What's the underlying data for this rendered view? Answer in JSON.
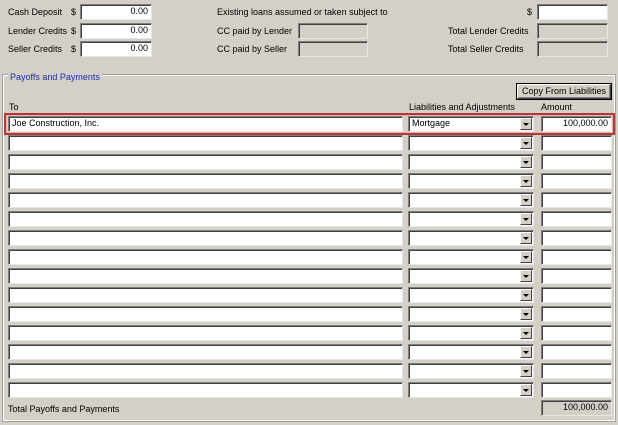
{
  "top": {
    "cash_deposit": {
      "label": "Cash Deposit",
      "currency": "$",
      "value": "0.00"
    },
    "lender_credits": {
      "label": "Lender Credits",
      "currency": "$",
      "value": "0.00"
    },
    "seller_credits": {
      "label": "Seller Credits",
      "currency": "$",
      "value": "0.00"
    },
    "existing_loans": {
      "label": "Existing loans assumed or taken subject to",
      "currency": "$",
      "value": ""
    },
    "cc_paid_lender": {
      "label": "CC paid by  Lender",
      "value": ""
    },
    "cc_paid_seller": {
      "label": "CC paid by  Seller",
      "value": ""
    },
    "total_lender_credits": {
      "label": "Total Lender Credits",
      "value": ""
    },
    "total_seller_credits": {
      "label": "Total Seller Credits",
      "value": ""
    }
  },
  "payoffs": {
    "section_title": "Payoffs and Payments",
    "copy_button": "Copy From Liabilities",
    "col_to": "To",
    "col_liabilities": "Liabilities and Adjustments",
    "col_amount": "Amount",
    "rows": [
      {
        "to": "Joe Construction, Inc.",
        "liability": "Mortgage",
        "amount": "100,000.00"
      },
      {
        "to": "",
        "liability": "",
        "amount": ""
      },
      {
        "to": "",
        "liability": "",
        "amount": ""
      },
      {
        "to": "",
        "liability": "",
        "amount": ""
      },
      {
        "to": "",
        "liability": "",
        "amount": ""
      },
      {
        "to": "",
        "liability": "",
        "amount": ""
      },
      {
        "to": "",
        "liability": "",
        "amount": ""
      },
      {
        "to": "",
        "liability": "",
        "amount": ""
      },
      {
        "to": "",
        "liability": "",
        "amount": ""
      },
      {
        "to": "",
        "liability": "",
        "amount": ""
      },
      {
        "to": "",
        "liability": "",
        "amount": ""
      },
      {
        "to": "",
        "liability": "",
        "amount": ""
      },
      {
        "to": "",
        "liability": "",
        "amount": ""
      },
      {
        "to": "",
        "liability": "",
        "amount": ""
      },
      {
        "to": "",
        "liability": "",
        "amount": ""
      }
    ],
    "total_label": "Total Payoffs and Payments",
    "total_value": "100,000.00"
  }
}
